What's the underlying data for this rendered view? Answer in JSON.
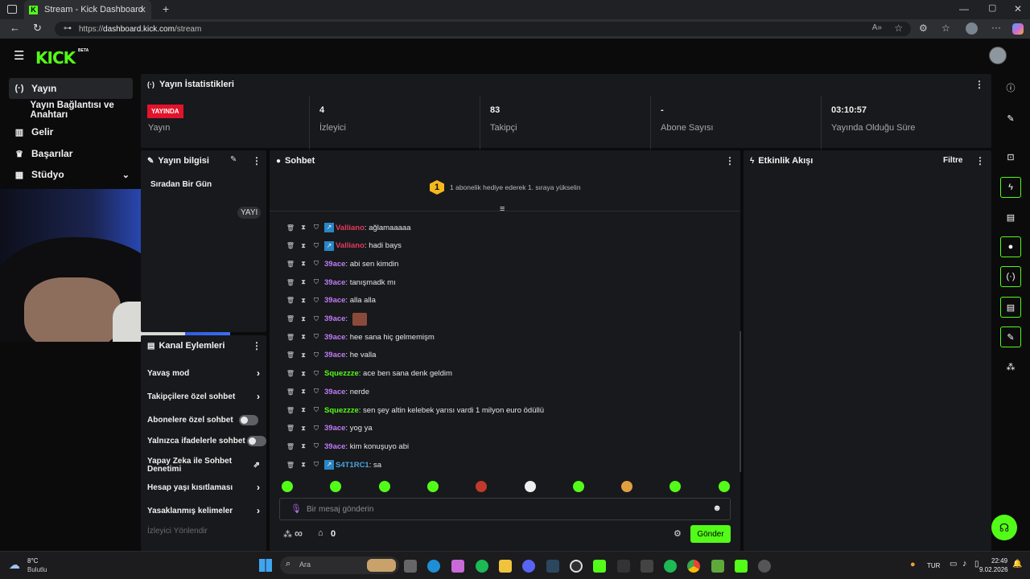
{
  "browser": {
    "tab_title": "Stream - Kick Dashboard",
    "url_prefix": "https://",
    "url_host": "dashboard.kick.com",
    "url_path": "/stream"
  },
  "header": {
    "logo": "KICK",
    "beta": "BETA"
  },
  "sidebar": {
    "items": [
      {
        "label": "Yayın",
        "icon": "broadcast-icon"
      },
      {
        "label": "Yayın Bağlantısı ve Anahtarı",
        "icon": ""
      },
      {
        "label": "Gelir",
        "icon": "chart-icon"
      },
      {
        "label": "Başarılar",
        "icon": "trophy-icon"
      },
      {
        "label": "Stüdyo",
        "icon": "studio-icon"
      }
    ]
  },
  "stats": {
    "title": "Yayın İstatistikleri",
    "live_badge": "YAYINDA",
    "live_label": "Yayın",
    "viewers_value": "4",
    "viewers_label": "İzleyici",
    "followers_value": "83",
    "followers_label": "Takipçi",
    "subs_value": "-",
    "subs_label": "Abone Sayısı",
    "uptime_value": "03:10:57",
    "uptime_label": "Yayında Olduğu Süre"
  },
  "stream_info": {
    "title": "Yayın bilgisi",
    "stream_title": "Sıradan Bir Gün",
    "tag": "YAYI"
  },
  "channel_actions": {
    "title": "Kanal Eylemleri",
    "items": [
      {
        "label": "Yavaş mod",
        "type": "chevron"
      },
      {
        "label": "Takipçilere özel sohbet",
        "type": "chevron"
      },
      {
        "label": "Abonelere özel sohbet",
        "type": "toggle"
      },
      {
        "label": "Yalnızca ifadelerle sohbet",
        "type": "toggle"
      },
      {
        "label": "Yapay Zeka ile Sohbet Denetimi",
        "type": "external"
      },
      {
        "label": "Hesap yaşı kısıtlaması",
        "type": "chevron"
      },
      {
        "label": "Yasaklanmış kelimeler",
        "type": "chevron"
      },
      {
        "label": "İzleyici Yönlendir",
        "type": "none"
      }
    ]
  },
  "chat": {
    "title": "Sohbet",
    "gift_rank": "1",
    "gift_text": "1 abonelik hediye ederek 1. sıraya yükselin",
    "messages": [
      {
        "user": "Valliano",
        "color": "#e53a5c",
        "badge": true,
        "text": "ağlamaaaaa"
      },
      {
        "user": "Valliano",
        "color": "#e53a5c",
        "badge": true,
        "text": "hadi bays"
      },
      {
        "user": "39ace",
        "color": "#c07cf7",
        "badge": false,
        "text": "abi sen kimdin"
      },
      {
        "user": "39ace",
        "color": "#c07cf7",
        "badge": false,
        "text": "tanışmadk mı"
      },
      {
        "user": "39ace",
        "color": "#c07cf7",
        "badge": false,
        "text": "alla alla"
      },
      {
        "user": "39ace",
        "color": "#c07cf7",
        "badge": false,
        "text": "",
        "emote": true
      },
      {
        "user": "39ace",
        "color": "#c07cf7",
        "badge": false,
        "text": "hee sana hiç gelmemişm"
      },
      {
        "user": "39ace",
        "color": "#c07cf7",
        "badge": false,
        "text": "he valla"
      },
      {
        "user": "Squezzze",
        "color": "#53fc18",
        "badge": false,
        "text": "ace ben sana denk geldim"
      },
      {
        "user": "39ace",
        "color": "#c07cf7",
        "badge": false,
        "text": "nerde"
      },
      {
        "user": "Squezzze",
        "color": "#53fc18",
        "badge": false,
        "text": "sen şey altin kelebek yarısı vardi 1 milyon euro ödüllü"
      },
      {
        "user": "39ace",
        "color": "#c07cf7",
        "badge": false,
        "text": "yog ya"
      },
      {
        "user": "39ace",
        "color": "#c07cf7",
        "badge": false,
        "text": "kim konuşuyo abi"
      },
      {
        "user": "S4T1RC1",
        "color": "#4aa3df",
        "badge": true,
        "text": "sa"
      }
    ],
    "input_placeholder": "Bir mesaj gönderin",
    "points": "∞",
    "shop_count": "0",
    "send_label": "Gönder"
  },
  "activity": {
    "title": "Etkinlik Akışı",
    "filter_label": "Filtre"
  },
  "taskbar": {
    "weather_temp": "8°C",
    "weather_desc": "Bulutlu",
    "search_label": "Ara",
    "lang": "TUR",
    "time": "22:49",
    "date": "9.02.2026"
  },
  "colors": {
    "accent": "#53fc18",
    "live": "#e2132c",
    "panel": "#18191c",
    "bg": "#0b0b0c"
  }
}
